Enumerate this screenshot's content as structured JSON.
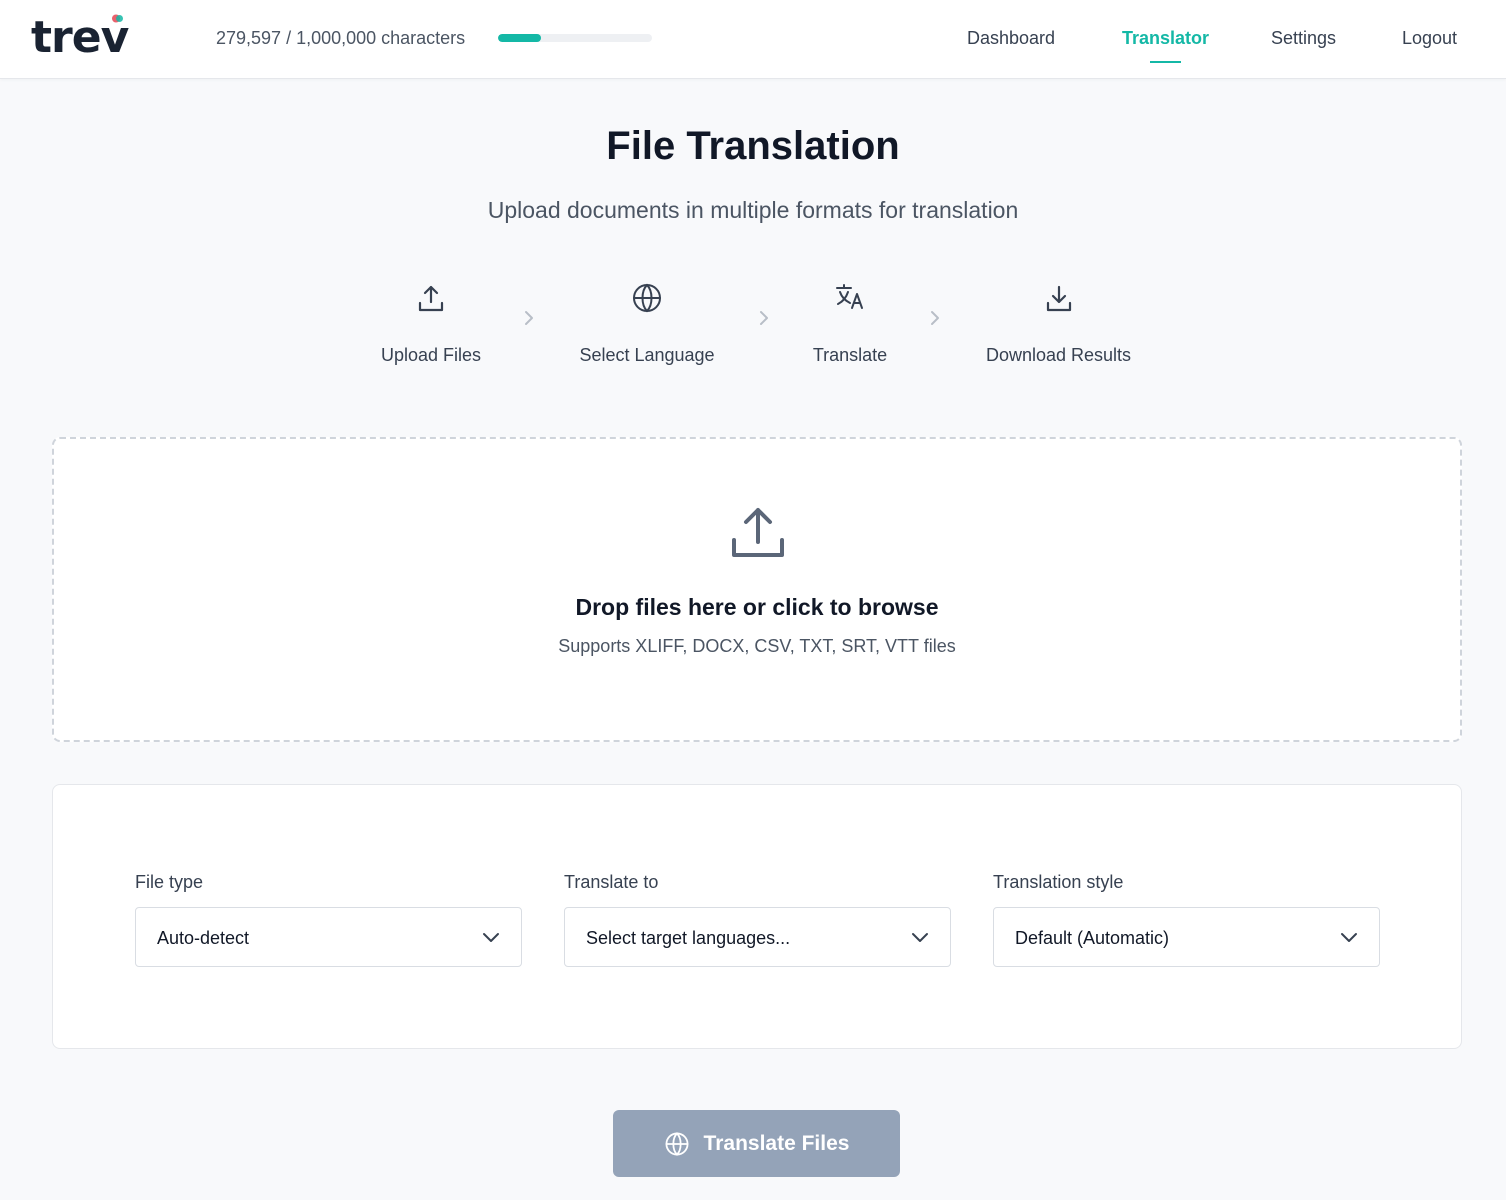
{
  "brand": {
    "name": "trev",
    "dot_colors": [
      "#e8616c",
      "#14b8a6"
    ]
  },
  "usage": {
    "text": "279,597 / 1,000,000 characters",
    "fraction": 0.279597,
    "bar_color": "#14b8a6"
  },
  "nav": {
    "items": [
      {
        "label": "Dashboard",
        "active": false
      },
      {
        "label": "Translator",
        "active": true
      },
      {
        "label": "Settings",
        "active": false
      },
      {
        "label": "Logout",
        "active": false
      }
    ],
    "accent_color": "#14b8a6"
  },
  "page": {
    "title": "File Translation",
    "subtitle": "Upload documents in multiple formats for translation"
  },
  "steps": [
    {
      "label": "Upload Files",
      "icon": "upload-icon"
    },
    {
      "label": "Select Language",
      "icon": "globe-icon"
    },
    {
      "label": "Translate",
      "icon": "translate-icon"
    },
    {
      "label": "Download Results",
      "icon": "download-icon"
    }
  ],
  "dropzone": {
    "icon": "upload-icon",
    "title": "Drop files here or click to browse",
    "subtitle": "Supports XLIFF, DOCX, CSV, TXT, SRT, VTT files"
  },
  "options": {
    "file_type": {
      "label": "File type",
      "value": "Auto-detect"
    },
    "translate_to": {
      "label": "Translate to",
      "placeholder": "Select target languages..."
    },
    "style": {
      "label": "Translation style",
      "value": "Default (Automatic)"
    }
  },
  "action": {
    "label": "Translate Files",
    "icon": "globe-icon",
    "disabled": true,
    "color": "#94a3b8"
  }
}
